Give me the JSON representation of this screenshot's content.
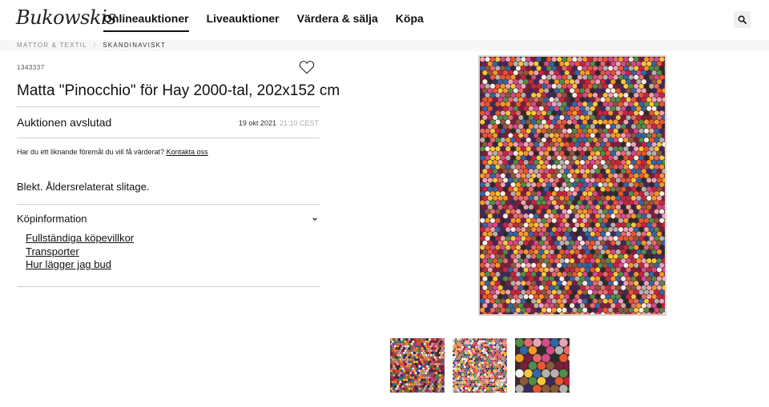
{
  "brand": {
    "logo_text": "Bukowskis"
  },
  "nav": [
    {
      "label": "Onlineauktioner",
      "active": true
    },
    {
      "label": "Liveauktioner",
      "active": false
    },
    {
      "label": "Värdera & sälja",
      "active": false
    },
    {
      "label": "Köpa",
      "active": false
    }
  ],
  "header": {
    "search_icon": "search-icon"
  },
  "breadcrumb": {
    "items": [
      "MATTOR & TEXTIL",
      "SKANDINAVISKT"
    ],
    "separator": "/"
  },
  "lot": {
    "number": "1343337",
    "title": "Matta \"Pinocchio\" för Hay 2000-tal, 202x152 cm",
    "favorite_icon": "heart-icon"
  },
  "auction": {
    "status": "Auktionen avslutad",
    "end_date": "19 okt 2021",
    "end_time": "21:10 CEST"
  },
  "valuation": {
    "text": "Har du ett liknande föremål du vill få värderat?",
    "link": "Kontakta oss"
  },
  "condition": "Blekt. Åldersrelaterat slitage.",
  "purchase_info": {
    "heading": "Köpinformation",
    "expanded": true,
    "links": [
      "Fullständiga köpevillkor",
      "Transporter",
      "Hur lägger jag bud"
    ]
  },
  "colors": {
    "rug_palette": [
      "#c9243f",
      "#e8572e",
      "#f29a26",
      "#f6c93a",
      "#7a1f3d",
      "#3a2a5e",
      "#d24b8c",
      "#eaa6b6",
      "#f4efe6",
      "#2b2b2b",
      "#4f8f4a",
      "#2f67a8",
      "#8a5a3c",
      "#b5b1ad",
      "#e36b6b"
    ]
  },
  "gallery": {
    "thumbnail_count": 3,
    "selected": 0
  }
}
